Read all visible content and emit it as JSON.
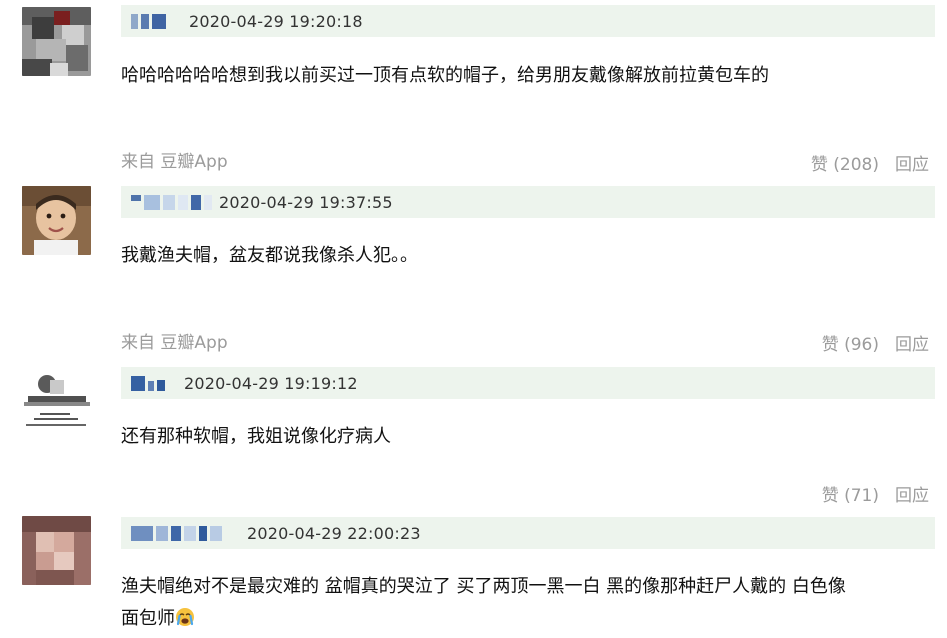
{
  "comments": [
    {
      "timestamp": "2020-04-29 19:20:18",
      "text": "哈哈哈哈哈哈想到我以前买过一顶有点软的帽子，给男朋友戴像解放前拉黄包车的",
      "source": "来自 豆瓣App",
      "like_label": "赞 (208)",
      "reply_label": "回应"
    },
    {
      "timestamp": "2020-04-29 19:37:55",
      "text": "我戴渔夫帽，盆友都说我像杀人犯。。",
      "source": "来自 豆瓣App",
      "like_label": "赞 (96)",
      "reply_label": "回应"
    },
    {
      "timestamp": "2020-04-29 19:19:12",
      "text": "还有那种软帽，我姐说像化疗病人",
      "like_label": "赞 (71)",
      "reply_label": "回应"
    },
    {
      "timestamp": "2020-04-29 22:00:23",
      "text_line1": "渔夫帽绝对不是最灾难的 盆帽真的哭泣了 买了两顶一黑一白 黑的像那种赶尸人戴的 白色像",
      "text_line2": "面包师"
    }
  ],
  "colors": {
    "header_bg": "#edf4ed",
    "meta_text": "#9b9b9b",
    "body_text": "#111111"
  },
  "icons": {
    "emoji": "loudly-crying-face-icon"
  }
}
